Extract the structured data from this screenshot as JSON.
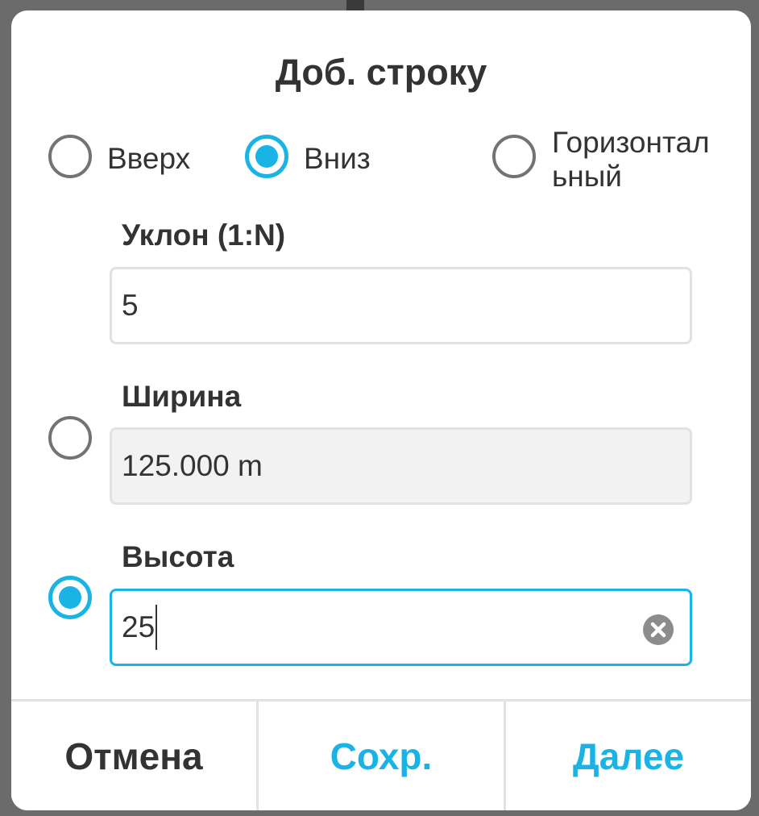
{
  "dialog": {
    "title": "Доб. строку"
  },
  "direction": {
    "options": [
      {
        "label": "Вверх",
        "checked": false
      },
      {
        "label": "Вниз",
        "checked": true
      },
      {
        "label_line1": "Горизонтал",
        "label_line2": "ьный",
        "checked": false
      }
    ]
  },
  "slope": {
    "label": "Уклон (1:N)",
    "value": "5"
  },
  "width": {
    "label": "Ширина",
    "value": "125.000 m",
    "selected": false,
    "disabled": true
  },
  "height": {
    "label": "Высота",
    "value": "25",
    "selected": true,
    "focused": true
  },
  "buttons": {
    "cancel": "Отмена",
    "save": "Сохр.",
    "next": "Далее"
  },
  "colors": {
    "accent": "#1ab3e6",
    "text": "#333333",
    "border": "#e2e2e2",
    "disabled_bg": "#f2f2f2"
  },
  "icons": {
    "clear": "clear-circle-icon"
  }
}
